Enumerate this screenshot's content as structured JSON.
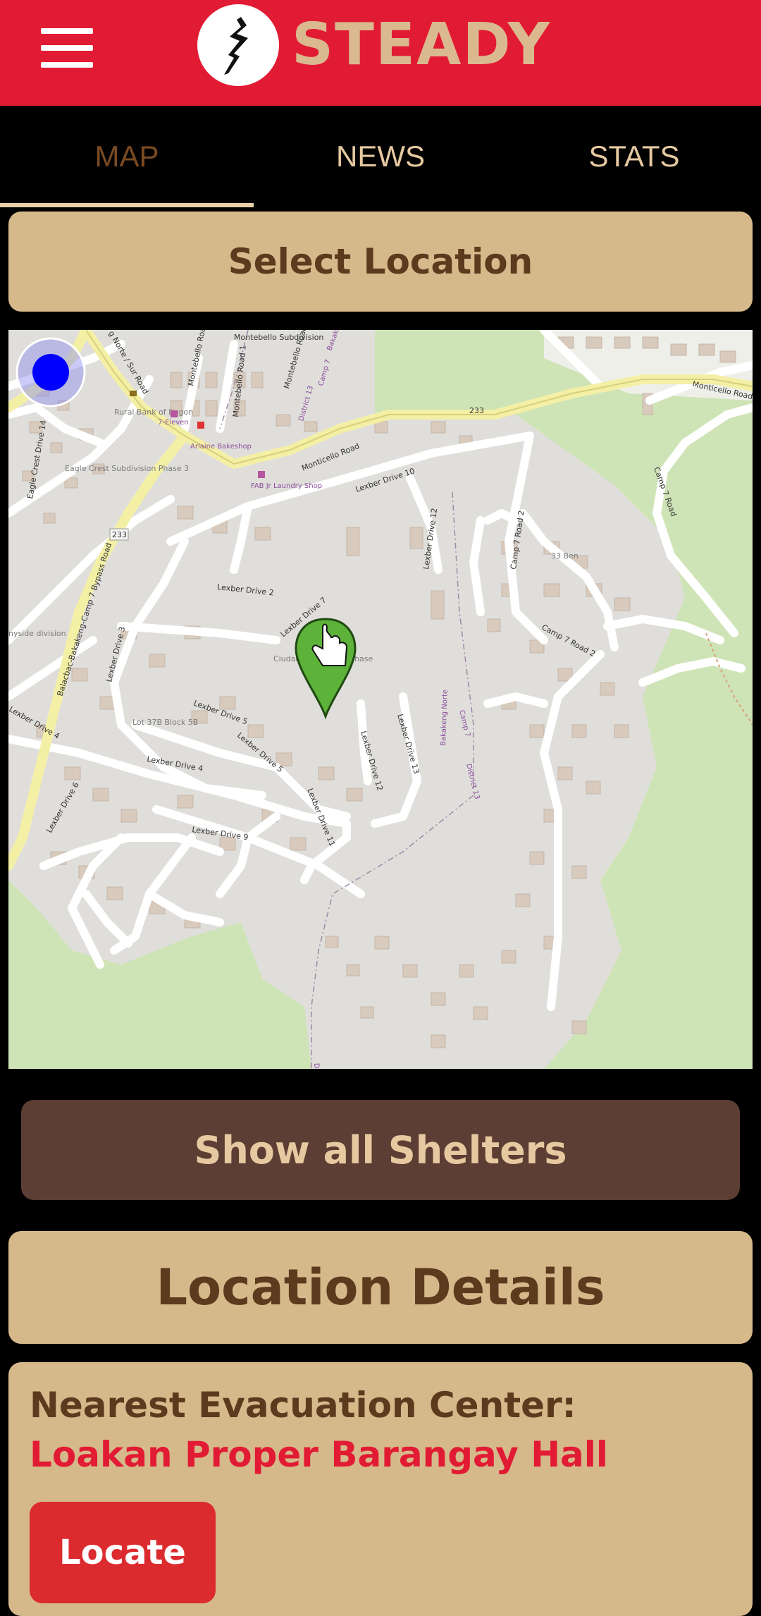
{
  "header": {
    "title": "STEADY",
    "menu_icon": "hamburger-menu-icon",
    "logo_icon": "cracked-ground-logo-icon",
    "brand_color": "#e21b34"
  },
  "tabs": [
    {
      "label": "MAP",
      "active": true
    },
    {
      "label": "NEWS",
      "active": false
    },
    {
      "label": "STATS",
      "active": false
    }
  ],
  "select_location_label": "Select Location",
  "map": {
    "road_labels": {
      "montebello_road": "Montebello Road",
      "montebello_road_1": "Montebello Road 1",
      "montebello_road_2": "Montebello Road",
      "montebello_subdivision": "Montebello Subdivision",
      "district_13": "District 13",
      "camp_7": "Camp 7",
      "bakakeng": "Bakakeng",
      "route_233": "233",
      "route_233_b": "233",
      "monticello_road": "Monticello Road",
      "monticello_road_2": "Monticello Road",
      "camp_7_road": "Camp 7 Road",
      "eagle_crest_drive_14": "Eagle Crest Drive 14",
      "eagle_crest_subdivision": "Eagle Crest Subdivision Phase 3",
      "rural_bank": "Rural Bank of Itogon",
      "seven_eleven": "7-Eleven",
      "arlaine_bakeshop": "Arlaine Bakeshop",
      "fab_jr_laundry": "FAB Jr Laundry Shop",
      "lexber_drive_10": "Lexber Drive 10",
      "lexber_drive_12": "Lexber Drive 12",
      "camp_7_road_2": "Camp 7 Road 2",
      "camp_7_road_2_b": "Camp 7 Road 2",
      "ben_33": "33 Ben",
      "lexber_drive_2": "Lexber Drive 2",
      "lexber_drive_7": "Lexber Drive 7",
      "ciudad_subdivision": "Ciudad Subdivision Phase",
      "balacbac_bypass": "Balacbac-Bakakeng-Camp 7 Bypass Road",
      "lexber_drive_3": "Lexber Drive 3",
      "lexber_drive_4": "Lexber Drive 4",
      "lexber_drive_4_b": "Lexber Drive 4",
      "lexber_drive_5": "Lexber Drive 5",
      "lexber_drive_5_b": "Lexber Drive 5",
      "lexber_drive_6": "Lexber Drive 6",
      "lexber_drive_9": "Lexber Drive 9",
      "lexber_drive_11": "Lexber Drive 11",
      "lexber_drive_12_b": "Lexber Drive 12",
      "lexber_drive_13": "Lexber Drive 13",
      "lot_37b": "Lot 37B Block 5B",
      "bakakeng_norte": "Bakakeng Norte",
      "district_13_b": "District 13",
      "camp_7_b": "Camp 7",
      "district_b": "District",
      "nyside_division": "nyside division",
      "sur_road": "g Norte / Sur Road"
    },
    "current_location_icon": "current-location-dot-icon",
    "marker_icon": "green-location-pin-icon",
    "cursor_icon": "pointing-hand-cursor-icon"
  },
  "show_shelters_label": "Show all Shelters",
  "location_details": {
    "title": "Location Details",
    "nearest_label": "Nearest Evacuation Center:",
    "center_name": "Loakan Proper Barangay Hall",
    "locate_label": "Locate"
  }
}
